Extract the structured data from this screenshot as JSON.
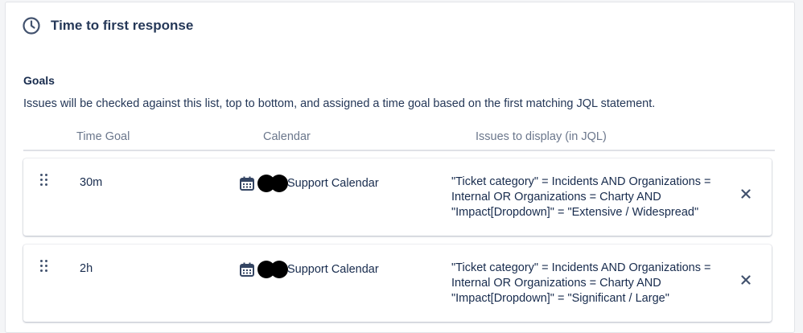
{
  "section": {
    "title": "Time to first response",
    "icon": "clock-icon"
  },
  "goals": {
    "title": "Goals",
    "description": "Issues will be checked against this list, top to bottom, and assigned a time goal based on the first matching JQL statement.",
    "columns": {
      "time_goal": "Time Goal",
      "calendar": "Calendar",
      "jql": "Issues to display (in JQL)"
    },
    "rows": [
      {
        "time": "30m",
        "calendar_icon": "calendar-icon",
        "calendar_name": "Support Calendar",
        "jql": "\"Ticket category\" = Incidents AND Organizations = Internal OR Organizations = Charty AND \"Impact[Dropdown]\" = \"Extensive / Widespread\"",
        "remove_icon": "close-icon"
      },
      {
        "time": "2h",
        "calendar_icon": "calendar-icon",
        "calendar_name": "Support Calendar",
        "jql": "\"Ticket category\" = Incidents AND Organizations = Internal OR Organizations = Charty AND \"Impact[Dropdown]\" = \"Significant / Large\"",
        "remove_icon": "close-icon"
      }
    ]
  },
  "colors": {
    "text_primary": "#172b4d",
    "text_subtle": "#6b778c",
    "icon": "#42526e",
    "calendar_icon": "#344563"
  }
}
